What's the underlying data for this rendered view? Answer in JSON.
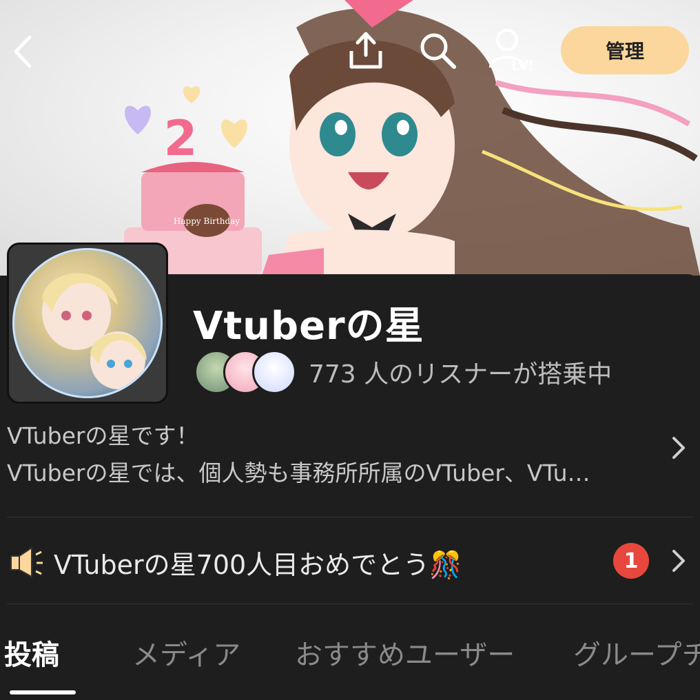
{
  "header": {
    "manage_label": "管理",
    "user_level": "LV5",
    "icons": [
      "back-icon",
      "share-icon",
      "search-icon",
      "user-level-icon"
    ]
  },
  "banner": {
    "cake_text": "Happy Birthday",
    "cake_number": "2"
  },
  "group": {
    "title": "Vtuberの星",
    "listeners_text": "773 人のリスナーが搭乗中",
    "description_line1": "VTuberの星です！",
    "description_line2": "VTuberの星では、個人勢も事務所所属のVTuber、VTu…"
  },
  "announcement": {
    "text": "VTuberの星700人目おめでとう🎊",
    "badge_count": "1"
  },
  "tabs": [
    {
      "label": "投稿"
    },
    {
      "label": "メディア"
    },
    {
      "label": "おすすめユーザー"
    },
    {
      "label": "グループチ"
    }
  ],
  "colors": {
    "manage_bg": "#fbd79d",
    "badge_red": "#e8473d",
    "panel_bg": "#1e1e1e"
  }
}
